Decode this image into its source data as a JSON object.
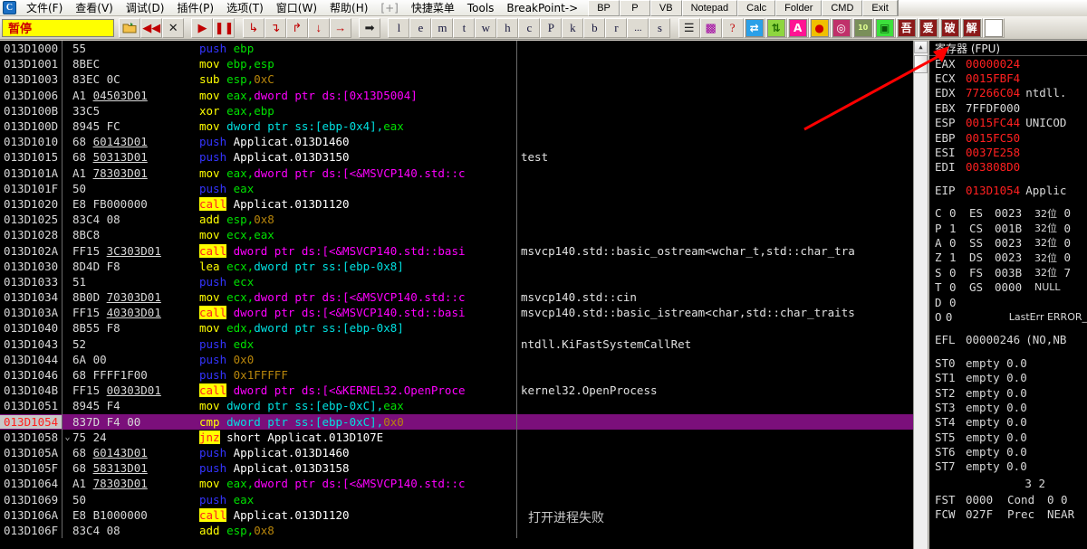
{
  "app": {
    "logo_letter": "C",
    "status": "暂停"
  },
  "menu": {
    "items": [
      {
        "label": "文件(F)",
        "dim": false
      },
      {
        "label": "查看(V)",
        "dim": false
      },
      {
        "label": "调试(D)",
        "dim": false
      },
      {
        "label": "插件(P)",
        "dim": false
      },
      {
        "label": "选项(T)",
        "dim": false
      },
      {
        "label": "窗口(W)",
        "dim": false
      },
      {
        "label": "帮助(H)",
        "dim": false
      },
      {
        "label": "[+]",
        "dim": true
      },
      {
        "label": "快捷菜单",
        "dim": false
      },
      {
        "label": "Tools",
        "dim": false
      },
      {
        "label": "BreakPoint->",
        "dim": false
      }
    ],
    "buttons": [
      "BP",
      "P",
      "VB",
      "Notepad",
      "Calc",
      "Folder",
      "CMD",
      "Exit"
    ]
  },
  "toolbar": {
    "nav_icons": [
      "open-folder-icon",
      "restart-icon",
      "close-icon"
    ],
    "run_icons": [
      "run-icon",
      "pause-icon"
    ],
    "step_icons": [
      "step-into-icon",
      "step-over-icon",
      "step-into-alt-icon",
      "step-out-icon",
      "execute-till-return-icon"
    ],
    "trace_icon": "trace-into-icon",
    "letters": [
      "l",
      "e",
      "m",
      "t",
      "w",
      "h",
      "c",
      "P",
      "k",
      "b",
      "r",
      "...",
      "s"
    ],
    "extras": [
      "list-icon",
      "pattern-icon",
      "help-icon"
    ],
    "plugin_icons": [
      {
        "name": "swap-icon",
        "glyph": "⇄",
        "bg": "#2aa0e8",
        "fg": "#ffffff"
      },
      {
        "name": "updown-icon",
        "glyph": "⇅",
        "bg": "#8ed63f",
        "fg": "#1e6b00"
      },
      {
        "name": "ascii-icon",
        "glyph": "A",
        "bg": "#ff1493",
        "fg": "#ffffff"
      },
      {
        "name": "record-icon",
        "glyph": "●",
        "bg": "#f0c000",
        "fg": "#d00000"
      },
      {
        "name": "target-icon",
        "glyph": "◎",
        "bg": "#c0306a",
        "fg": "#ffffff"
      },
      {
        "name": "binary-icon",
        "glyph": "10",
        "bg": "#7a8f5a",
        "fg": "#e0ff90"
      },
      {
        "name": "calc-icon",
        "glyph": "▣",
        "bg": "#3ce03c",
        "fg": "#0a5a0a"
      },
      {
        "name": "wu-icon",
        "glyph": "吾",
        "bg": "#8b1a1a",
        "fg": "#ffffff"
      },
      {
        "name": "ai-icon",
        "glyph": "爱",
        "bg": "#8b1a1a",
        "fg": "#ffffff"
      },
      {
        "name": "po-icon",
        "glyph": "破",
        "bg": "#8b1a1a",
        "fg": "#ffffff"
      },
      {
        "name": "jie-icon",
        "glyph": "解",
        "bg": "#8b1a1a",
        "fg": "#ffffff"
      },
      {
        "name": "blank-icon",
        "glyph": "",
        "bg": "#ffffff",
        "fg": "#ffffff"
      }
    ]
  },
  "disasm": {
    "rows": [
      {
        "addr": "013D1000",
        "arrow": "",
        "bytes": "55",
        "bytes_u": "",
        "dis": [
          [
            "mn-push",
            "push "
          ],
          [
            "reg",
            "ebp"
          ]
        ],
        "cmt": ""
      },
      {
        "addr": "013D1001",
        "arrow": "",
        "bytes": "8BEC",
        "bytes_u": "",
        "dis": [
          [
            "mn-mov",
            "mov "
          ],
          [
            "reg",
            "ebp,esp"
          ]
        ],
        "cmt": ""
      },
      {
        "addr": "013D1003",
        "arrow": "",
        "bytes": "83EC 0C",
        "bytes_u": "",
        "dis": [
          [
            "mn-sub",
            "sub "
          ],
          [
            "reg",
            "esp,"
          ],
          [
            "num",
            "0xC"
          ]
        ],
        "cmt": ""
      },
      {
        "addr": "013D1006",
        "arrow": "",
        "bytes": "A1 ",
        "bytes_u": "04503D01",
        "dis": [
          [
            "mn-mov",
            "mov "
          ],
          [
            "reg",
            "eax,"
          ],
          [
            "ptr",
            "dword ptr ds:[0x13D5004]"
          ]
        ],
        "cmt": ""
      },
      {
        "addr": "013D100B",
        "arrow": "",
        "bytes": "33C5",
        "bytes_u": "",
        "dis": [
          [
            "mn-xor",
            "xor "
          ],
          [
            "reg",
            "eax,ebp"
          ]
        ],
        "cmt": ""
      },
      {
        "addr": "013D100D",
        "arrow": "",
        "bytes": "8945 FC",
        "bytes_u": "",
        "dis": [
          [
            "mn-mov",
            "mov "
          ],
          [
            "ss",
            "dword ptr ss:[ebp-0x4],"
          ],
          [
            "reg",
            "eax"
          ]
        ],
        "cmt": ""
      },
      {
        "addr": "013D1010",
        "arrow": "",
        "bytes": "68 ",
        "bytes_u": "60143D01",
        "dis": [
          [
            "mn-push",
            "push "
          ],
          [
            "sym",
            "Applicat.013D1460"
          ]
        ],
        "cmt": ""
      },
      {
        "addr": "013D1015",
        "arrow": "",
        "bytes": "68 ",
        "bytes_u": "50313D01",
        "dis": [
          [
            "mn-push",
            "push "
          ],
          [
            "sym",
            "Applicat.013D3150"
          ]
        ],
        "cmt": "test"
      },
      {
        "addr": "013D101A",
        "arrow": "",
        "bytes": "A1 ",
        "bytes_u": "78303D01",
        "dis": [
          [
            "mn-mov",
            "mov "
          ],
          [
            "reg",
            "eax,"
          ],
          [
            "ptr",
            "dword ptr ds:[<&MSVCP140.std::c"
          ]
        ],
        "cmt": ""
      },
      {
        "addr": "013D101F",
        "arrow": "",
        "bytes": "50",
        "bytes_u": "",
        "dis": [
          [
            "mn-push",
            "push "
          ],
          [
            "reg",
            "eax"
          ]
        ],
        "cmt": ""
      },
      {
        "addr": "013D1020",
        "arrow": "",
        "bytes": "E8 FB000000",
        "bytes_u": "",
        "dis": [
          [
            "mn-call",
            "call"
          ],
          [
            "sym",
            " Applicat.013D1120"
          ]
        ],
        "cmt": ""
      },
      {
        "addr": "013D1025",
        "arrow": "",
        "bytes": "83C4 08",
        "bytes_u": "",
        "dis": [
          [
            "mn-add",
            "add "
          ],
          [
            "reg",
            "esp,"
          ],
          [
            "num",
            "0x8"
          ]
        ],
        "cmt": ""
      },
      {
        "addr": "013D1028",
        "arrow": "",
        "bytes": "8BC8",
        "bytes_u": "",
        "dis": [
          [
            "mn-mov",
            "mov "
          ],
          [
            "reg",
            "ecx,eax"
          ]
        ],
        "cmt": ""
      },
      {
        "addr": "013D102A",
        "arrow": "",
        "bytes": "FF15 ",
        "bytes_u": "3C303D01",
        "dis": [
          [
            "mn-call",
            "call"
          ],
          [
            "ptr",
            " dword ptr ds:[<&MSVCP140.std::basi"
          ]
        ],
        "cmt": "msvcp140.std::basic_ostream<wchar_t,std::char_tra"
      },
      {
        "addr": "013D1030",
        "arrow": "",
        "bytes": "8D4D F8",
        "bytes_u": "",
        "dis": [
          [
            "mn-lea",
            "lea "
          ],
          [
            "reg",
            "ecx,"
          ],
          [
            "ss",
            "dword ptr ss:[ebp-0x8]"
          ]
        ],
        "cmt": ""
      },
      {
        "addr": "013D1033",
        "arrow": "",
        "bytes": "51",
        "bytes_u": "",
        "dis": [
          [
            "mn-push",
            "push "
          ],
          [
            "reg",
            "ecx"
          ]
        ],
        "cmt": ""
      },
      {
        "addr": "013D1034",
        "arrow": "",
        "bytes": "8B0D ",
        "bytes_u": "70303D01",
        "dis": [
          [
            "mn-mov",
            "mov "
          ],
          [
            "reg",
            "ecx,"
          ],
          [
            "ptr",
            "dword ptr ds:[<&MSVCP140.std::c"
          ]
        ],
        "cmt": "msvcp140.std::cin"
      },
      {
        "addr": "013D103A",
        "arrow": "",
        "bytes": "FF15 ",
        "bytes_u": "40303D01",
        "dis": [
          [
            "mn-call",
            "call"
          ],
          [
            "ptr",
            " dword ptr ds:[<&MSVCP140.std::basi"
          ]
        ],
        "cmt": "msvcp140.std::basic_istream<char,std::char_traits"
      },
      {
        "addr": "013D1040",
        "arrow": "",
        "bytes": "8B55 F8",
        "bytes_u": "",
        "dis": [
          [
            "mn-mov",
            "mov "
          ],
          [
            "reg",
            "edx,"
          ],
          [
            "ss",
            "dword ptr ss:[ebp-0x8]"
          ]
        ],
        "cmt": ""
      },
      {
        "addr": "013D1043",
        "arrow": "",
        "bytes": "52",
        "bytes_u": "",
        "dis": [
          [
            "mn-push",
            "push "
          ],
          [
            "reg",
            "edx"
          ]
        ],
        "cmt": "ntdll.KiFastSystemCallRet"
      },
      {
        "addr": "013D1044",
        "arrow": "",
        "bytes": "6A 00",
        "bytes_u": "",
        "dis": [
          [
            "mn-push",
            "push "
          ],
          [
            "num",
            "0x0"
          ]
        ],
        "cmt": ""
      },
      {
        "addr": "013D1046",
        "arrow": "",
        "bytes": "68 FFFF1F00",
        "bytes_u": "",
        "dis": [
          [
            "mn-push",
            "push "
          ],
          [
            "num",
            "0x1FFFFF"
          ]
        ],
        "cmt": ""
      },
      {
        "addr": "013D104B",
        "arrow": "",
        "bytes": "FF15 ",
        "bytes_u": "00303D01",
        "dis": [
          [
            "mn-call",
            "call"
          ],
          [
            "ptr",
            " dword ptr ds:[<&KERNEL32.OpenProce"
          ]
        ],
        "cmt": "kernel32.OpenProcess"
      },
      {
        "addr": "013D1051",
        "arrow": "",
        "bytes": "8945 F4",
        "bytes_u": "",
        "dis": [
          [
            "mn-mov",
            "mov "
          ],
          [
            "ss",
            "dword ptr ss:[ebp-0xC],"
          ],
          [
            "reg",
            "eax"
          ]
        ],
        "cmt": ""
      },
      {
        "addr": "013D1054",
        "arrow": "",
        "bytes": "837D F4 00",
        "bytes_u": "",
        "dis": [
          [
            "mn-cmp",
            "cmp "
          ],
          [
            "ss",
            "dword ptr ss:[ebp-0xC],"
          ],
          [
            "num",
            "0x0"
          ]
        ],
        "cmt": "",
        "selected": true,
        "current": true
      },
      {
        "addr": "013D1058",
        "arrow": "⌄",
        "bytes": "75 24",
        "bytes_u": "",
        "dis": [
          [
            "mn-jnz",
            "jnz"
          ],
          [
            "sym",
            " short Applicat.013D107E"
          ]
        ],
        "cmt": ""
      },
      {
        "addr": "013D105A",
        "arrow": "",
        "bytes": "68 ",
        "bytes_u": "60143D01",
        "dis": [
          [
            "mn-push",
            "push "
          ],
          [
            "sym",
            "Applicat.013D1460"
          ]
        ],
        "cmt": ""
      },
      {
        "addr": "013D105F",
        "arrow": "",
        "bytes": "68 ",
        "bytes_u": "58313D01",
        "dis": [
          [
            "mn-push",
            "push "
          ],
          [
            "sym",
            "Applicat.013D3158"
          ]
        ],
        "cmt": ""
      },
      {
        "addr": "013D1064",
        "arrow": "",
        "bytes": "A1 ",
        "bytes_u": "78303D01",
        "dis": [
          [
            "mn-mov",
            "mov "
          ],
          [
            "reg",
            "eax,"
          ],
          [
            "ptr",
            "dword ptr ds:[<&MSVCP140.std::c"
          ]
        ],
        "cmt": ""
      },
      {
        "addr": "013D1069",
        "arrow": "",
        "bytes": "50",
        "bytes_u": "",
        "dis": [
          [
            "mn-push",
            "push "
          ],
          [
            "reg",
            "eax"
          ]
        ],
        "cmt": ""
      },
      {
        "addr": "013D106A",
        "arrow": "",
        "bytes": "E8 B1000000",
        "bytes_u": "",
        "dis": [
          [
            "mn-call",
            "call"
          ],
          [
            "sym",
            " Applicat.013D1120"
          ]
        ],
        "cmt": ""
      },
      {
        "addr": "013D106F",
        "arrow": "",
        "bytes": "83C4 08",
        "bytes_u": "",
        "dis": [
          [
            "mn-add",
            "add "
          ],
          [
            "reg",
            "esp,"
          ],
          [
            "num",
            "0x8"
          ]
        ],
        "cmt": ""
      }
    ],
    "overlay_note": "打开进程失败"
  },
  "registers": {
    "title": "寄存器 (FPU)",
    "general": [
      {
        "name": "EAX",
        "value": "00000024",
        "extra": "",
        "changed": true
      },
      {
        "name": "ECX",
        "value": "0015FBF4",
        "extra": "",
        "changed": true
      },
      {
        "name": "EDX",
        "value": "77266C04",
        "extra": "ntdll.",
        "changed": true
      },
      {
        "name": "EBX",
        "value": "7FFDF000",
        "extra": "",
        "changed": false
      },
      {
        "name": "ESP",
        "value": "0015FC44",
        "extra": "UNICOD",
        "changed": true
      },
      {
        "name": "EBP",
        "value": "0015FC50",
        "extra": "",
        "changed": true
      },
      {
        "name": "ESI",
        "value": "0037E258",
        "extra": "",
        "changed": true
      },
      {
        "name": "EDI",
        "value": "003808D0",
        "extra": "",
        "changed": true
      }
    ],
    "eip": {
      "name": "EIP",
      "value": "013D1054",
      "extra": "Applic"
    },
    "flags": [
      {
        "flag": "C",
        "fval": "0",
        "seg": "ES",
        "sval": "0023",
        "desc": "32位",
        "tail": "0"
      },
      {
        "flag": "P",
        "fval": "1",
        "seg": "CS",
        "sval": "001B",
        "desc": "32位",
        "tail": "0"
      },
      {
        "flag": "A",
        "fval": "0",
        "seg": "SS",
        "sval": "0023",
        "desc": "32位",
        "tail": "0"
      },
      {
        "flag": "Z",
        "fval": "1",
        "seg": "DS",
        "sval": "0023",
        "desc": "32位",
        "tail": "0"
      },
      {
        "flag": "S",
        "fval": "0",
        "seg": "FS",
        "sval": "003B",
        "desc": "32位",
        "tail": "7"
      },
      {
        "flag": "T",
        "fval": "0",
        "seg": "GS",
        "sval": "0000",
        "desc": "NULL",
        "tail": ""
      },
      {
        "flag": "D",
        "fval": "0",
        "seg": "",
        "sval": "",
        "desc": "",
        "tail": ""
      },
      {
        "flag": "O",
        "fval": "0",
        "seg": "",
        "sval": "",
        "desc": "LastErr ERROR_",
        "tail": ""
      }
    ],
    "efl": {
      "name": "EFL",
      "value": "00000246",
      "extra": "(NO,NB"
    },
    "fpu": [
      {
        "name": "ST0",
        "state": "empty",
        "value": "0.0"
      },
      {
        "name": "ST1",
        "state": "empty",
        "value": "0.0"
      },
      {
        "name": "ST2",
        "state": "empty",
        "value": "0.0"
      },
      {
        "name": "ST3",
        "state": "empty",
        "value": "0.0"
      },
      {
        "name": "ST4",
        "state": "empty",
        "value": "0.0"
      },
      {
        "name": "ST5",
        "state": "empty",
        "value": "0.0"
      },
      {
        "name": "ST6",
        "state": "empty",
        "value": "0.0"
      },
      {
        "name": "ST7",
        "state": "empty",
        "value": "0.0"
      }
    ],
    "fpu_header": "3 2",
    "fst": {
      "name": "FST",
      "value": "0000",
      "label": "Cond",
      "bits": "0 0"
    },
    "fcw": {
      "name": "FCW",
      "value": "027F",
      "label": "Prec",
      "bits": "NEAR"
    }
  },
  "annotation": {
    "arrow_color": "#ff0000",
    "arrow_name": "red-pointer-arrow"
  }
}
